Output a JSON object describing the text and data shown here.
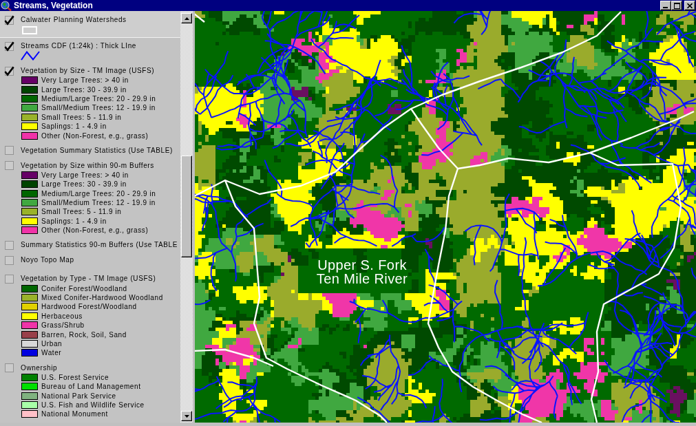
{
  "window": {
    "title": "Streams, Vegetation"
  },
  "legend": {
    "themes": [
      {
        "name": "Calwater Planning Watersheds",
        "kind": "outline",
        "checked": true,
        "selected": true
      },
      {
        "name": "Streams CDF (1:24k) : Thick LIne",
        "kind": "line",
        "checked": true,
        "selected": false
      },
      {
        "name": "Vegetation by Size - TM Image (USFS)",
        "kind": "classes",
        "checked": true,
        "selected": false,
        "classes": [
          {
            "label": "Very Large Trees: > 40 in",
            "color": "#660066"
          },
          {
            "label": "Large Trees: 30 - 39.9 in",
            "color": "#004400"
          },
          {
            "label": "Medium/Large Trees: 20 - 29.9 in",
            "color": "#006600"
          },
          {
            "label": "Small/Medium Trees: 12 - 19.9 in",
            "color": "#40a840"
          },
          {
            "label": "Small Trees: 5 - 11.9 in",
            "color": "#99b22a"
          },
          {
            "label": "Saplings: 1 - 4.9 in",
            "color": "#ffff00"
          },
          {
            "label": "Other (Non-Forest, e.g., grass)",
            "color": "#f033a8"
          }
        ]
      },
      {
        "name": "Vegetation Summary Statistics (Use TABLE)",
        "kind": "plain",
        "checked": false,
        "selected": false
      },
      {
        "name": "Vegetation by Size within 90-m Buffers",
        "kind": "classes",
        "checked": false,
        "selected": false,
        "classes": [
          {
            "label": "Very Large Trees: > 40 in",
            "color": "#660066"
          },
          {
            "label": "Large Trees: 30 - 39.9 in",
            "color": "#004400"
          },
          {
            "label": "Medium/Large Trees: 20 - 29.9 in",
            "color": "#006600"
          },
          {
            "label": "Small/Medium Trees: 12 - 19.9 in",
            "color": "#40a840"
          },
          {
            "label": "Small Trees: 5 - 11.9 in",
            "color": "#99b22a"
          },
          {
            "label": "Saplings: 1 - 4.9 in",
            "color": "#ffff00"
          },
          {
            "label": "Other (Non-Forest, e.g., grass)",
            "color": "#f033a8"
          }
        ]
      },
      {
        "name": "Summary Statistics 90-m Buffers (Use TABLE",
        "kind": "plain",
        "checked": false,
        "selected": false
      },
      {
        "name": "Noyo Topo Map",
        "kind": "image",
        "checked": false,
        "selected": false
      },
      {
        "name": "Vegetation by Type - TM Image (USFS)",
        "kind": "classes",
        "checked": false,
        "selected": false,
        "classes": [
          {
            "label": "Conifer Forest/Woodland",
            "color": "#006600"
          },
          {
            "label": "Mixed Conifer-Hardwood Woodland",
            "color": "#99b22a"
          },
          {
            "label": "Hardwood Forest/Woodland",
            "color": "#e0d000"
          },
          {
            "label": "Herbaceous",
            "color": "#ffff00"
          },
          {
            "label": "Grass/Shrub",
            "color": "#f033a8"
          },
          {
            "label": "Barren, Rock, Soil, Sand",
            "color": "#99404a"
          },
          {
            "label": "Urban",
            "color": "#d8d8d8"
          },
          {
            "label": "Water",
            "color": "#0000e0"
          }
        ]
      },
      {
        "name": "Ownership",
        "kind": "classes",
        "checked": false,
        "selected": false,
        "classes": [
          {
            "label": "U.S. Forest Service",
            "color": "#008000"
          },
          {
            "label": "Bureau of Land Management",
            "color": "#00e000"
          },
          {
            "label": "National Park Service",
            "color": "#7fb27f"
          },
          {
            "label": "U.S. Fish and Wildlife Service",
            "color": "#a8ffa8"
          },
          {
            "label": "National Monument",
            "color": "#ffc0c8"
          }
        ]
      }
    ]
  },
  "map": {
    "label_lines": [
      "Upper S. Fork",
      "Ten Mile River"
    ]
  }
}
